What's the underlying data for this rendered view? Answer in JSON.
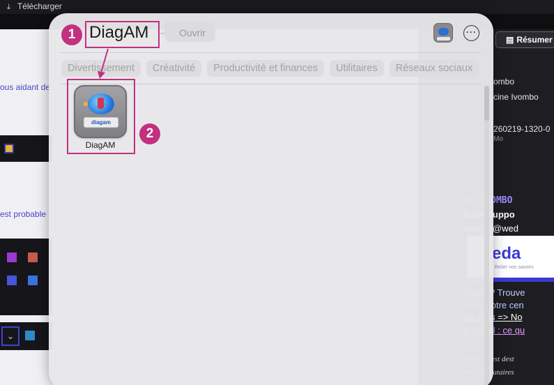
{
  "background": {
    "download_label": "Télécharger",
    "left_texts": [
      "ous aidant de",
      "est probable"
    ],
    "resume_button": "Résumer",
    "right_list": [
      "ombo",
      "cine Ivombo",
      "260219-1320-0",
      "Mo"
    ],
    "signature": {
      "name": "ie IVOMBO",
      "role": "icien Suppo",
      "email": "ivombo@wed",
      "logo_word": "eda",
      "logo_tagline": "Relier nos savoirs",
      "lines": [
        "d'aide ? Trouve",
        "n sur notre cen",
        "du mois => No",
        "e travail : ce qu"
      ],
      "italic_lines": [
        "message est dest",
        "ses destinataires"
      ]
    }
  },
  "launcher": {
    "search_term": "DiagAM",
    "separator": "—",
    "action_label": "Ouvrir",
    "more_button_label": "···",
    "categories": [
      "Divertissement",
      "Créativité",
      "Productivité et finances",
      "Utilitaires",
      "Réseaux sociaux"
    ],
    "results": [
      {
        "name": "DiagAM",
        "icon": "diagam-app-icon",
        "icon_band_text": "diagam"
      }
    ]
  },
  "annotations": {
    "badge1": "1",
    "badge2": "2",
    "color": "#c2307f"
  }
}
